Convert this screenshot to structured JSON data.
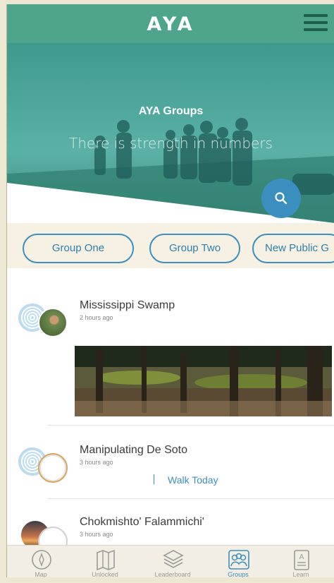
{
  "header": {
    "logo": "AYA"
  },
  "hero": {
    "title": "AYA Groups",
    "subtitle": "There is strength in numbers"
  },
  "groups": [
    {
      "label": "Group One"
    },
    {
      "label": "Group Two"
    },
    {
      "label": "New Public G"
    }
  ],
  "feed": [
    {
      "title": "Mississippi Swamp",
      "time": "2 hours ago"
    },
    {
      "title": "Manipulating De Soto",
      "time": "3 hours ago",
      "link": "Walk Today"
    },
    {
      "title": "Chokmishto' Falammichi'",
      "time": "3 hours ago"
    }
  ],
  "nav": [
    {
      "label": "Map",
      "icon": "compass-icon"
    },
    {
      "label": "Unlocked",
      "icon": "map-icon"
    },
    {
      "label": "Leaderboard",
      "icon": "layers-icon"
    },
    {
      "label": "Groups",
      "icon": "group-icon",
      "active": true
    },
    {
      "label": "Learn",
      "icon": "book-icon"
    }
  ],
  "colors": {
    "header": "#4ea58b",
    "accent": "#3b8fbf",
    "chips_bg": "#f6f1e2"
  }
}
